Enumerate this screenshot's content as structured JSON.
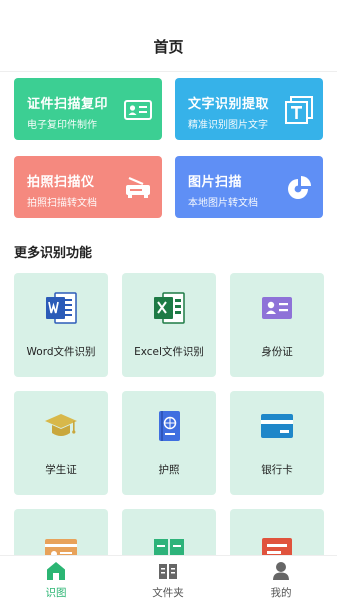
{
  "header": {
    "title": "首页"
  },
  "feature_cards": [
    {
      "title": "证件扫描复印",
      "subtitle": "电子复印件制作",
      "icon": "id-card-icon",
      "color": "#3ccf93"
    },
    {
      "title": "文字识别提取",
      "subtitle": "精准识别图片文字",
      "icon": "text-t-icon",
      "color": "#36b2e9"
    },
    {
      "title": "拍照扫描仪",
      "subtitle": "拍照扫描转文档",
      "icon": "scanner-icon",
      "color": "#f5897f"
    },
    {
      "title": "图片扫描",
      "subtitle": "本地图片转文档",
      "icon": "pie-chart-icon",
      "color": "#5f8ff5"
    }
  ],
  "more_section": {
    "title": "更多识别功能",
    "items": [
      {
        "label": "Word文件识别",
        "icon": "word-doc-icon"
      },
      {
        "label": "Excel文件识别",
        "icon": "excel-doc-icon"
      },
      {
        "label": "身份证",
        "icon": "id-card-icon"
      },
      {
        "label": "学生证",
        "icon": "graduation-cap-icon"
      },
      {
        "label": "护照",
        "icon": "passport-icon"
      },
      {
        "label": "银行卡",
        "icon": "bank-card-icon"
      },
      {
        "label": "",
        "icon": "card-icon"
      },
      {
        "label": "",
        "icon": "book-icon"
      },
      {
        "label": "",
        "icon": "document-icon"
      }
    ]
  },
  "tabbar": {
    "items": [
      {
        "label": "识图",
        "icon": "home-icon",
        "active": true
      },
      {
        "label": "文件夹",
        "icon": "folder-icon",
        "active": false
      },
      {
        "label": "我的",
        "icon": "user-icon",
        "active": false
      }
    ],
    "active_color": "#2bb573"
  }
}
